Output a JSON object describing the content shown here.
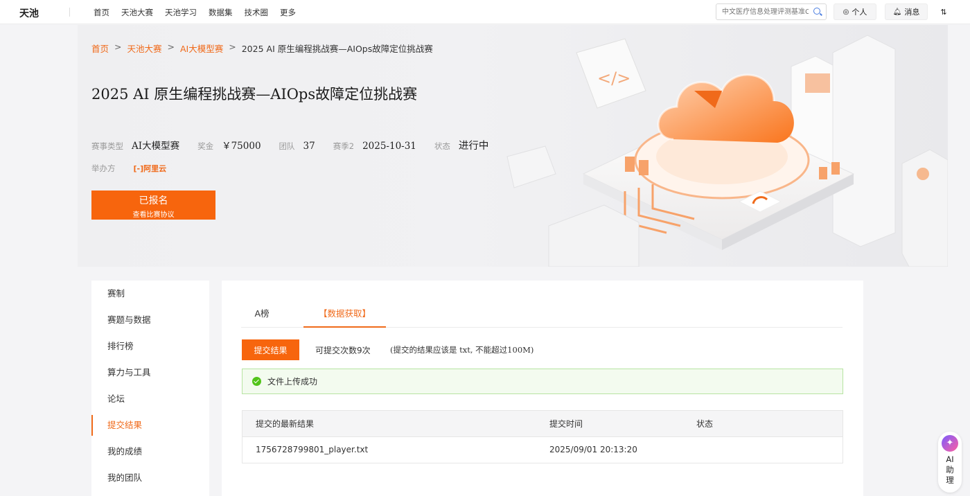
{
  "topnav": {
    "logo": "天池",
    "items": [
      "首页",
      "天池大赛",
      "天池学习",
      "数据集",
      "技术圈",
      "更多"
    ],
    "search_placeholder": "中文医疗信息处理评测基准CBLUE",
    "personal_label": "个人",
    "messages_label": "消息"
  },
  "breadcrumb": {
    "home": "首页",
    "competitions": "天池大赛",
    "category": "AI大模型赛",
    "current": "2025 AI 原生编程挑战赛—AIOps故障定位挑战赛"
  },
  "competition": {
    "title": "2025 AI 原生编程挑战赛—AIOps故障定位挑战赛",
    "type_label": "赛事类型",
    "type_value": "AI大模型赛",
    "prize_label": "奖金",
    "prize_value": "￥75000",
    "teams_label": "团队",
    "teams_value": "37",
    "season_label": "赛季2",
    "season_value": "2025-10-31",
    "status_label": "状态",
    "status_value": "进行中",
    "organizer_label": "举办方",
    "organizer_name": "阿里云",
    "registered_label": "已报名",
    "agreement_label": "查看比赛协议"
  },
  "sidebar": {
    "items": [
      "赛制",
      "赛题与数据",
      "排行榜",
      "算力与工具",
      "论坛",
      "提交结果",
      "我的成绩",
      "我的团队"
    ],
    "active_index": 5
  },
  "main": {
    "tabs": [
      "A榜",
      "【数据获取】"
    ],
    "active_tab": 1,
    "submit_label": "提交结果",
    "remaining": "可提交次数9次",
    "hint": "(提交的结果应该是 txt, 不能超过100M)",
    "success_message": "文件上传成功",
    "table": {
      "headers": [
        "提交的最新结果",
        "提交时间",
        "状态"
      ],
      "rows": [
        {
          "file": "1756728799801_player.txt",
          "time": "2025/09/01 20:13:20",
          "status": ""
        }
      ]
    }
  },
  "assistant": {
    "line1": "AI",
    "line2": "助",
    "line3": "理"
  },
  "colors": {
    "accent": "#f7650d",
    "success": "#52c41a"
  }
}
